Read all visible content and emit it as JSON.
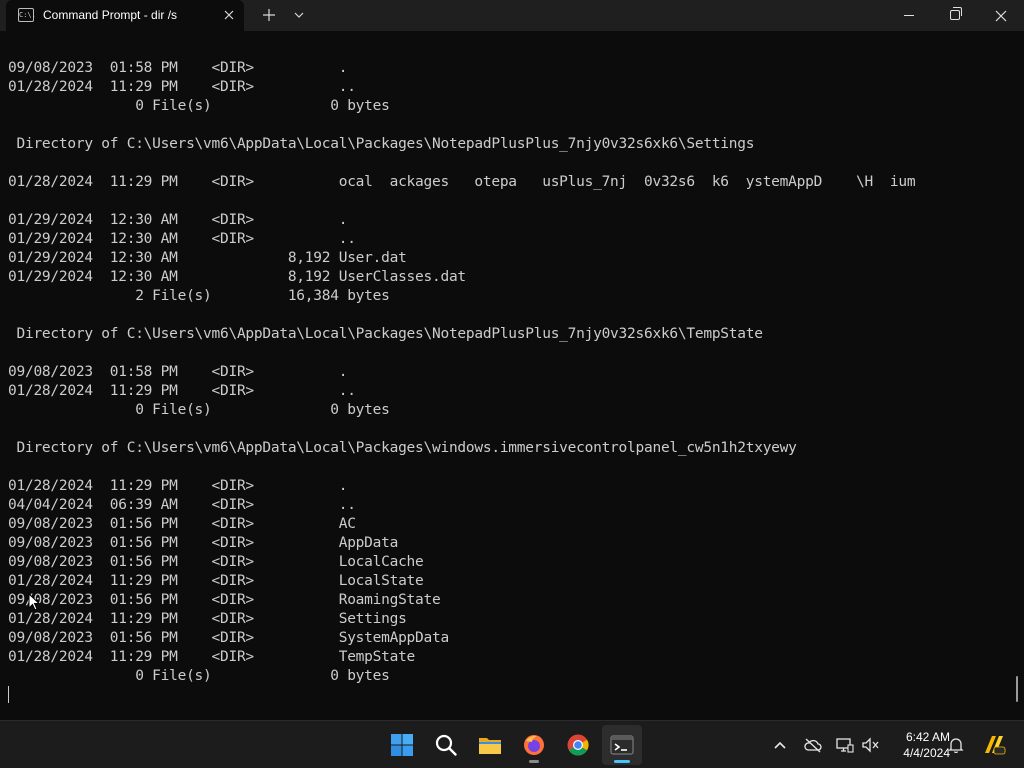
{
  "window": {
    "tab_title": "Command Prompt - dir /s",
    "tab_icon_text": "C:\\."
  },
  "terminal": {
    "lines": [
      "09/08/2023  01:58 PM    <DIR>          .",
      "01/28/2024  11:29 PM    <DIR>          ..",
      "               0 File(s)              0 bytes",
      "",
      " Directory of C:\\Users\\vm6\\AppData\\Local\\Packages\\NotepadPlusPlus_7njy0v32s6xk6\\Settings",
      "",
      "01/28/2024  11:29 PM    <DIR>          ocal  ackages   otepa   usPlus_7nj  0v32s6  k6  ystemAppD    \\H  ium",
      "",
      "01/29/2024  12:30 AM    <DIR>          .",
      "01/29/2024  12:30 AM    <DIR>          ..",
      "01/29/2024  12:30 AM             8,192 User.dat",
      "01/29/2024  12:30 AM             8,192 UserClasses.dat",
      "               2 File(s)         16,384 bytes",
      "",
      " Directory of C:\\Users\\vm6\\AppData\\Local\\Packages\\NotepadPlusPlus_7njy0v32s6xk6\\TempState",
      "",
      "09/08/2023  01:58 PM    <DIR>          .",
      "01/28/2024  11:29 PM    <DIR>          ..",
      "               0 File(s)              0 bytes",
      "",
      " Directory of C:\\Users\\vm6\\AppData\\Local\\Packages\\windows.immersivecontrolpanel_cw5n1h2txyewy",
      "",
      "01/28/2024  11:29 PM    <DIR>          .",
      "04/04/2024  06:39 AM    <DIR>          ..",
      "09/08/2023  01:56 PM    <DIR>          AC",
      "09/08/2023  01:56 PM    <DIR>          AppData",
      "09/08/2023  01:56 PM    <DIR>          LocalCache",
      "01/28/2024  11:29 PM    <DIR>          LocalState",
      "09/08/2023  01:56 PM    <DIR>          RoamingState",
      "01/28/2024  11:29 PM    <DIR>          Settings",
      "09/08/2023  01:56 PM    <DIR>          SystemAppData",
      "01/28/2024  11:29 PM    <DIR>          TempState",
      "               0 File(s)              0 bytes"
    ]
  },
  "taskbar": {
    "items": [
      {
        "id": "start",
        "icon": "windows-start-icon",
        "active": false
      },
      {
        "id": "search",
        "icon": "search-icon",
        "active": false
      },
      {
        "id": "explorer",
        "icon": "file-explorer-icon",
        "active": false
      },
      {
        "id": "firefox",
        "icon": "firefox-icon",
        "active": false,
        "running": true
      },
      {
        "id": "chrome",
        "icon": "chrome-icon",
        "active": false
      },
      {
        "id": "terminal",
        "icon": "terminal-icon",
        "active": true,
        "running": true
      }
    ],
    "clock_time": "6:42 AM",
    "clock_date": "4/4/2024"
  },
  "colors": {
    "terminal_bg": "#0c0c0c",
    "terminal_fg": "#cccccc",
    "accent": "#4cc2ff"
  }
}
